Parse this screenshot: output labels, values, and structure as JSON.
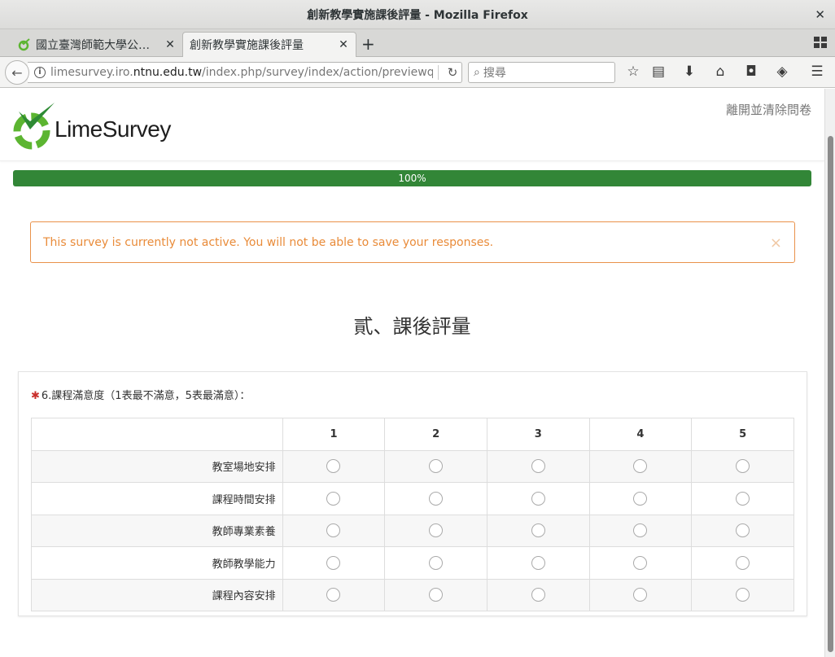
{
  "window": {
    "title": "創新教學實施課後評量 - Mozilla Firefox",
    "close_glyph": "✕"
  },
  "tabs": [
    {
      "label": "國立臺灣師範大學公…",
      "close_glyph": "✕",
      "favicon": "limesurvey-favicon-icon"
    },
    {
      "label": "創新教學實施課後評量",
      "close_glyph": "✕"
    }
  ],
  "toolbar": {
    "newtab_glyph": "+",
    "url_prefix": "limesurvey.iro.",
    "url_domain": "ntnu.edu.tw",
    "url_suffix": "/index.php/survey/index/action/previewque",
    "search_placeholder": "搜尋",
    "icons": [
      "bookmark-star-icon",
      "reading-list-icon",
      "download-icon",
      "home-icon",
      "pocket-icon",
      "sync-icon",
      "menu-icon"
    ]
  },
  "header": {
    "logo_text": "LimeSurvey",
    "exit_label": "離開並清除問卷"
  },
  "progress": {
    "value": 1.0,
    "label": "100%",
    "color": "#328637"
  },
  "alert": {
    "message": "This survey is currently not active. You will not be able to save your responses.",
    "close_glyph": "×",
    "color": "#e98b39"
  },
  "group_title": "貳、課後評量",
  "question": {
    "required_mark": "✱",
    "text": "6.課程滿意度（1表最不滿意，5表最滿意）：",
    "columns": [
      "1",
      "2",
      "3",
      "4",
      "5"
    ],
    "rows": [
      "教室場地安排",
      "課程時間安排",
      "教師專業素養",
      "教師教學能力",
      "課程內容安排"
    ]
  }
}
